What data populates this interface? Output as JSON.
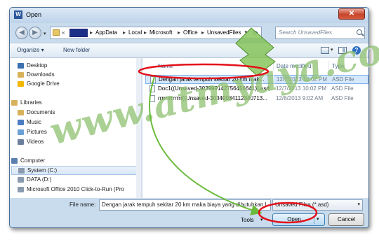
{
  "window": {
    "title": "Open",
    "app_icon": "W",
    "close_glyph": "✕"
  },
  "nav": {
    "back_glyph": "◀",
    "forward_glyph": "▶",
    "dropdown_glyph": "▾"
  },
  "address": {
    "prefix": "«",
    "crumbs": [
      "AppData",
      "Local",
      "Microsoft",
      "Office",
      "UnsavedFiles"
    ],
    "separator": "▸",
    "dropdown_glyph": "▾",
    "refresh_glyph": "⟳"
  },
  "search": {
    "placeholder": "Search UnsavedFiles"
  },
  "toolbar": {
    "organize": "Organize ▾",
    "new_folder": "New folder",
    "view_dropdown": "▾",
    "help": "?"
  },
  "sidebar": {
    "items": [
      {
        "label": "Desktop",
        "icon": "desktop-icon",
        "color": "#3a6fb0"
      },
      {
        "label": "Downloads",
        "icon": "downloads-icon",
        "color": "#d7b25a"
      },
      {
        "label": "Google Drive",
        "icon": "google-drive-icon",
        "color": "#f2b705"
      },
      {
        "label": "Libraries",
        "icon": "libraries-icon",
        "color": "#d7b25a"
      },
      {
        "label": "Documents",
        "icon": "documents-icon",
        "color": "#d7b25a"
      },
      {
        "label": "Music",
        "icon": "music-icon",
        "color": "#4a7cc2"
      },
      {
        "label": "Pictures",
        "icon": "pictures-icon",
        "color": "#6aa0d6"
      },
      {
        "label": "Videos",
        "icon": "videos-icon",
        "color": "#6a7f9c"
      },
      {
        "label": "Computer",
        "icon": "computer-icon",
        "color": "#5b7fae"
      },
      {
        "label": "System (C:)",
        "icon": "drive-icon",
        "color": "#8a9bb0"
      },
      {
        "label": "DATA (D:)",
        "icon": "drive-icon",
        "color": "#8a9bb0"
      },
      {
        "label": "Microsoft Office 2010 Click-to-Run (Pro",
        "icon": "drive-icon",
        "color": "#8a9bb0"
      }
    ]
  },
  "files": {
    "columns": {
      "name": "Name",
      "date": "Date modified",
      "type": "Type"
    },
    "rows": [
      {
        "name": "Dengan jarak tempuh sekitar 20 km mak...",
        "date": "12/7/2013 10:02 PM",
        "type": "ASD File"
      },
      {
        "name": "Doc1((Unsaved-303999142756456641)).asd",
        "date": "12/7/2013 10:02 PM",
        "type": "ASD File"
      },
      {
        "name": "rrrrrrrrrrrrr((Unsaved-30340084112340713...",
        "date": "12/8/2013 9:02 AM",
        "type": "ASD File"
      }
    ]
  },
  "bottom": {
    "file_name_label": "File name:",
    "file_name_value": "Dengan jarak tempuh sekitar 20 km maka biaya yang dibutuhkan l",
    "file_type": "Unsaved Files (*.asd)",
    "tools": "Tools",
    "open": "Open",
    "cancel": "Cancel"
  },
  "watermark": {
    "text": "www.atmyaya.com"
  },
  "annotation_colors": {
    "highlight": "#e3101a",
    "arrow_green": "#6cbb3c"
  }
}
